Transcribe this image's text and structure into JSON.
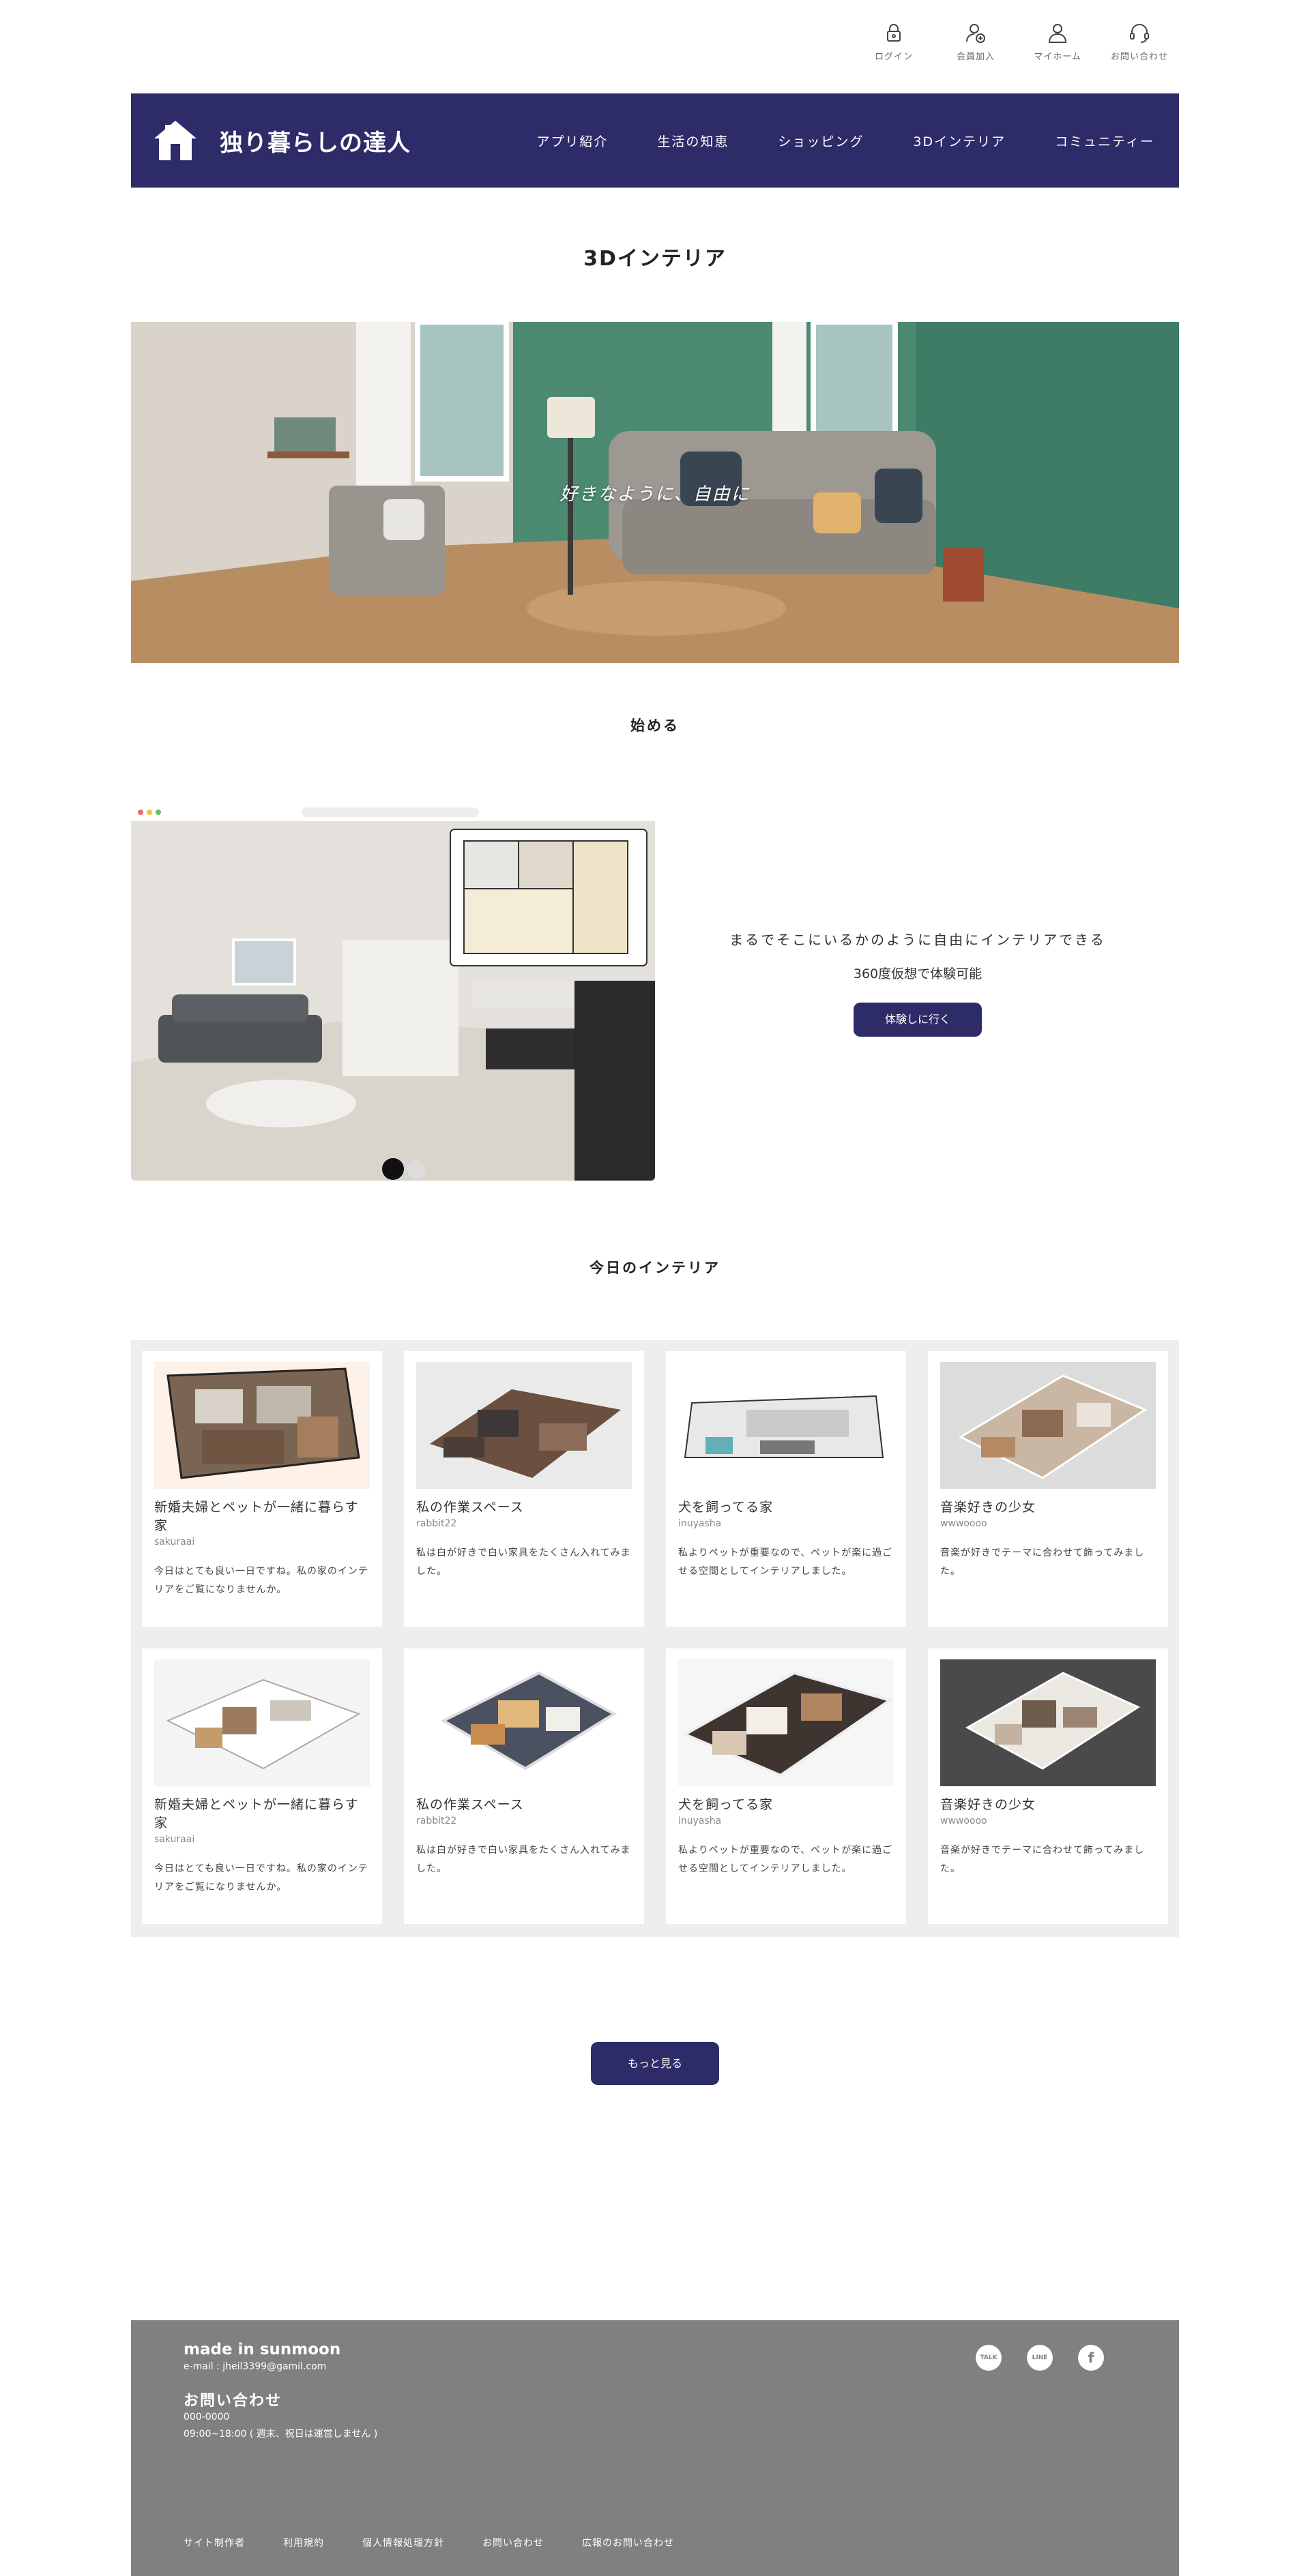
{
  "utility_nav": [
    {
      "label": "ログイン",
      "icon": "lock-icon"
    },
    {
      "label": "会員加入",
      "icon": "add-user-icon"
    },
    {
      "label": "マイホーム",
      "icon": "user-icon"
    },
    {
      "label": "お問い合わせ",
      "icon": "headset-icon"
    }
  ],
  "header": {
    "logo_text": "独り暮らしの達人",
    "logo_icon": "house-icon",
    "nav": [
      "アプリ紹介",
      "生活の知恵",
      "ショッピング",
      "3Dインテリア",
      "コミュニティー"
    ]
  },
  "page_title": "3Dインテリア",
  "hero": {
    "caption": "好きなように、自由に"
  },
  "start": {
    "heading": "始める",
    "lead": "まるでそこにいるかのように自由にインテリアできる",
    "sub": "360度仮想で体験可能",
    "button": "体験しに行く"
  },
  "today": {
    "heading": "今日のインテリア",
    "cards": [
      {
        "title": "新婚夫婦とペットが一緒に暮らす家",
        "user": "sakuraai",
        "desc": "今日はとても良い一日ですね。私の家のインテリアをご覧になりませんか。"
      },
      {
        "title": "私の作業スペース",
        "user": "rabbit22",
        "desc": "私は白が好きで白い家具をたくさん入れてみました。"
      },
      {
        "title": "犬を飼ってる家",
        "user": "inuyasha",
        "desc": "私よりペットが重要なので、ペットが楽に過ごせる空間としてインテリアしました。"
      },
      {
        "title": "音楽好きの少女",
        "user": "wwwoooo",
        "desc": "音楽が好きでテーマに合わせて飾ってみました。"
      },
      {
        "title": "新婚夫婦とペットが一緒に暮らす家",
        "user": "sakuraai",
        "desc": "今日はとても良い一日ですね。私の家のインテリアをご覧になりませんか。"
      },
      {
        "title": "私の作業スペース",
        "user": "rabbit22",
        "desc": "私は白が好きで白い家具をたくさん入れてみました。"
      },
      {
        "title": "犬を飼ってる家",
        "user": "inuyasha",
        "desc": "私よりペットが重要なので、ペットが楽に過ごせる空間としてインテリアしました。"
      },
      {
        "title": "音楽好きの少女",
        "user": "wwwoooo",
        "desc": "音楽が好きでテーマに合わせて飾ってみました。"
      }
    ],
    "more_button": "もっと見る"
  },
  "footer": {
    "brand": "made in sunmoon",
    "email": "e-mail : jheil3399@gamil.com",
    "contact_title": "お問い合わせ",
    "phone": "000-0000",
    "hours": "09:00~18:00 ( 週末、祝日は運営しません )",
    "social": [
      {
        "label": "TALK",
        "icon": "kakaotalk-icon"
      },
      {
        "label": "LINE",
        "icon": "line-icon"
      },
      {
        "label": "f",
        "icon": "facebook-icon"
      }
    ],
    "links": [
      "サイト制作者",
      "利用規約",
      "個人情報処理方針",
      "お問い合わせ",
      "広報のお問い合わせ"
    ]
  },
  "colors": {
    "brand": "#2e2b69",
    "footer": "#808080",
    "panel": "#eeeeee"
  }
}
